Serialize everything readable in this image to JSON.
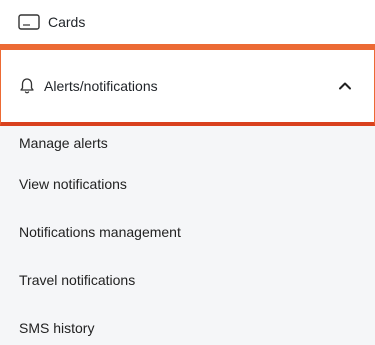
{
  "menu": {
    "cards": {
      "label": "Cards",
      "icon": "card-icon"
    },
    "alerts": {
      "label": "Alerts/notifications",
      "icon": "bell-icon",
      "expanded": true,
      "chevron": "chevron-up-icon"
    },
    "sub_items": [
      {
        "label": "Manage alerts"
      },
      {
        "label": "View notifications"
      },
      {
        "label": "Notifications management"
      },
      {
        "label": "Travel notifications"
      },
      {
        "label": "SMS history"
      }
    ]
  },
  "colors": {
    "accent_orange": "#ec6a34",
    "accent_red": "#d9411e",
    "submenu_bg": "#f5f6f8",
    "text": "#1f2328"
  }
}
